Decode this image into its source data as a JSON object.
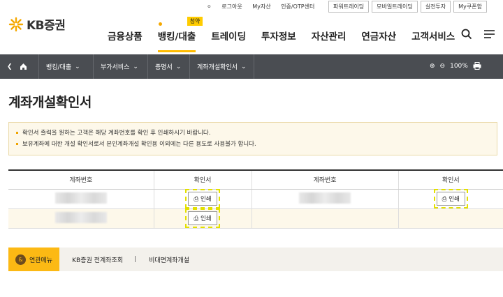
{
  "util": {
    "links": [
      "로그아웃",
      "My자산",
      "인증/OTP센터"
    ],
    "buttons": [
      "파워트레이딩",
      "모바일트레이딩",
      "실전투자",
      "My쿠폰함"
    ]
  },
  "logo": {
    "name": "KB증권"
  },
  "gnb": {
    "items": [
      "금융상품",
      "뱅킹/대출",
      "트레이딩",
      "투자정보",
      "자산관리",
      "연금자산",
      "고객서비스"
    ],
    "badge": "청약"
  },
  "path": {
    "crumbs": [
      "뱅킹/대출",
      "부가서비스",
      "증명서",
      "계좌개설확인서"
    ],
    "zoom": "100%"
  },
  "page": {
    "title": "계좌개설확인서"
  },
  "notice": [
    "확인서 출력을 원하는 고객은 해당 계좌번호를 확인 후 인쇄하시기 바랍니다.",
    "보유계좌에 대한 개설 확인서로서 본인계좌개설 확인용 이외에는 다른 용도로 사용불가 합니다."
  ],
  "table": {
    "headers": [
      "계좌번호",
      "확인서",
      "계좌번호",
      "확인서"
    ],
    "print_label": "인쇄"
  },
  "related": {
    "tag": "연관메뉴",
    "links": [
      "KB증권 전계좌조회",
      "비대면계좌개설"
    ],
    "separator": "|"
  },
  "colors": {
    "accent": "#fcb914",
    "pathbar": "#4a4d52"
  }
}
